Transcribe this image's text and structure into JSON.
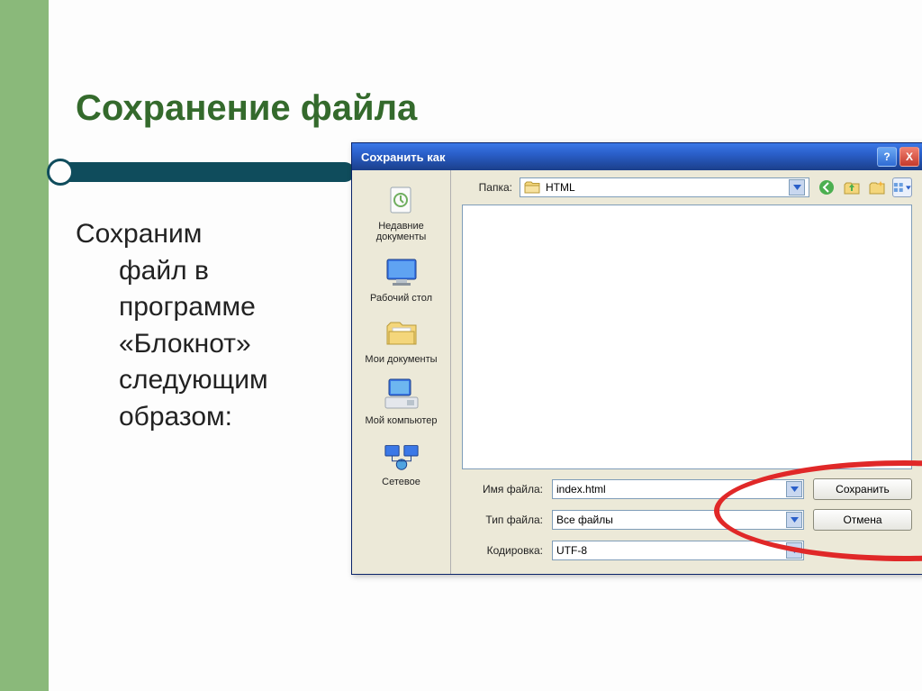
{
  "slide": {
    "title": "Сохранение файла",
    "body_line1": "Сохраним",
    "body_line2": "файл в",
    "body_line3": "программе",
    "body_line4": "«Блокнот»",
    "body_line5": "следующим",
    "body_line6": "образом:"
  },
  "dialog": {
    "title": "Сохранить как",
    "folder_label": "Папка:",
    "folder_value": "HTML",
    "places": {
      "recent": "Недавние документы",
      "desktop": "Рабочий стол",
      "mydocs": "Мои документы",
      "mycomp": "Мой компьютер",
      "network": "Сетевое"
    },
    "rows": {
      "filename_label": "Имя файла:",
      "filename_value": "index.html",
      "filetype_label": "Тип файла:",
      "filetype_value": "Все файлы",
      "encoding_label": "Кодировка:",
      "encoding_value": "UTF-8"
    },
    "buttons": {
      "save": "Сохранить",
      "cancel": "Отмена"
    }
  },
  "icons": {
    "help": "?",
    "close": "X"
  }
}
